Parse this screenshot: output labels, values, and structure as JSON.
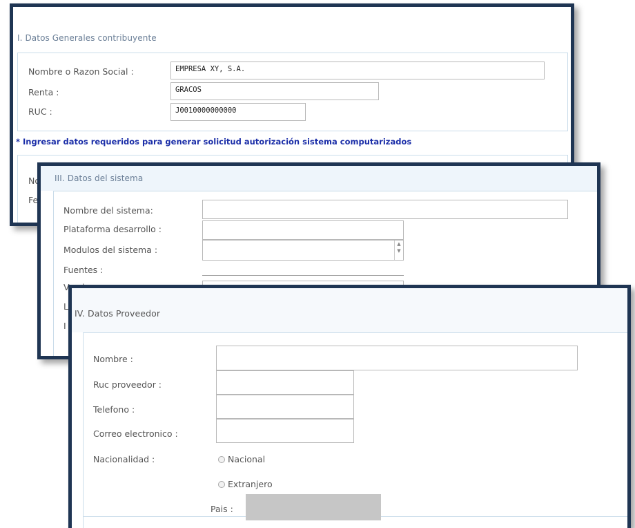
{
  "panel1": {
    "section_title": "I. Datos Generales contribuyente",
    "fields": [
      {
        "label": "Nombre o Razon Social :",
        "value": "EMPRESA XY, S.A."
      },
      {
        "label": "Renta :",
        "value": "GRACOS"
      },
      {
        "label": "RUC :",
        "value": "J0010000000000"
      }
    ],
    "note": "* Ingresar datos requeridos para generar solicitud autorización sistema computarizados",
    "partial_labels": [
      "No",
      "Fe"
    ]
  },
  "panel2": {
    "section_title": "III. Datos del sistema",
    "fields": [
      {
        "label": "Nombre del sistema:"
      },
      {
        "label": "Plataforma desarrollo :"
      },
      {
        "label": "Modulos del sistema :"
      },
      {
        "label": "Fuentes :"
      },
      {
        "label": "Version :"
      }
    ],
    "partial_labels": [
      "L",
      "I"
    ]
  },
  "panel3": {
    "section_title": "IV. Datos Proveedor",
    "fields": [
      {
        "label": "Nombre :",
        "value": ""
      },
      {
        "label": "Ruc proveedor :",
        "value": ""
      },
      {
        "label": "Telefono :",
        "value": ""
      },
      {
        "label": "Correo electronico :",
        "value": ""
      }
    ],
    "nacionalidad": {
      "label": "Nacionalidad :",
      "options": [
        "Nacional",
        "Extranjero"
      ]
    },
    "pais_label": "Pais :"
  },
  "colors": {
    "frame": "#1f3553",
    "note_text": "#1b2ea8",
    "section_title": "#6b7f97",
    "box_border": "#c9dcea"
  }
}
